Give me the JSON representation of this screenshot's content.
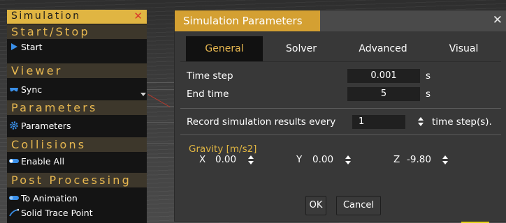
{
  "sidebar": {
    "title": "Simulation",
    "sections": [
      {
        "header": "Start/Stop",
        "items": [
          {
            "label": "Start",
            "icon": "play-icon"
          }
        ]
      },
      {
        "header": "Viewer",
        "items": [
          {
            "label": "Sync",
            "icon": "glasses-icon"
          }
        ]
      },
      {
        "header": "Parameters",
        "items": [
          {
            "label": "Parameters",
            "icon": "gear-icon"
          }
        ]
      },
      {
        "header": "Collisions",
        "items": [
          {
            "label": "Enable All",
            "icon": "toggle-icon"
          }
        ]
      },
      {
        "header": "Post Processing",
        "items": [
          {
            "label": "To Animation",
            "icon": "toggle-icon"
          },
          {
            "label": "Solid Trace Point",
            "icon": "trace-icon"
          }
        ]
      }
    ]
  },
  "dialog": {
    "title": "Simulation Parameters",
    "tabs": [
      {
        "label": "General",
        "active": true
      },
      {
        "label": "Solver",
        "active": false
      },
      {
        "label": "Advanced",
        "active": false
      },
      {
        "label": "Visual",
        "active": false
      }
    ],
    "time_step": {
      "label": "Time step",
      "value": "0.001",
      "unit": "s"
    },
    "end_time": {
      "label": "End time",
      "value": "5",
      "unit": "s"
    },
    "record": {
      "label": "Record simulation results every",
      "value": "1",
      "unit": "time step(s)."
    },
    "gravity": {
      "label": "Gravity [m/s2]",
      "x": {
        "axis": "X",
        "value": "0.00"
      },
      "y": {
        "axis": "Y",
        "value": "0.00"
      },
      "z": {
        "axis": "Z",
        "value": "-9.80"
      }
    },
    "ok_label": "OK",
    "cancel_label": "Cancel"
  },
  "colors": {
    "accent": "#e0b542",
    "section_text": "#e8b850",
    "close_red": "#d93a2b",
    "icon_blue": "#3a8fe8"
  }
}
